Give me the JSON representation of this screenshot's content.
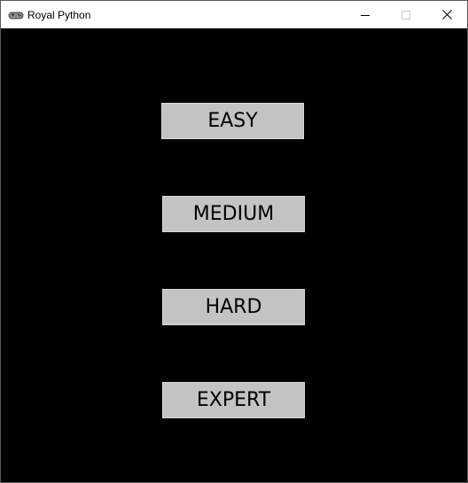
{
  "window": {
    "title": "Royal Python",
    "app_icon": "gamepad-icon",
    "controls": {
      "minimize": "minimize-icon",
      "maximize": "maximize-icon",
      "close": "close-icon"
    }
  },
  "menu": {
    "easy_label": "EASY",
    "medium_label": "MEDIUM",
    "hard_label": "HARD",
    "expert_label": "EXPERT"
  },
  "colors": {
    "background": "#000000",
    "button_fill": "#c3c3c3",
    "titlebar": "#ffffff"
  }
}
